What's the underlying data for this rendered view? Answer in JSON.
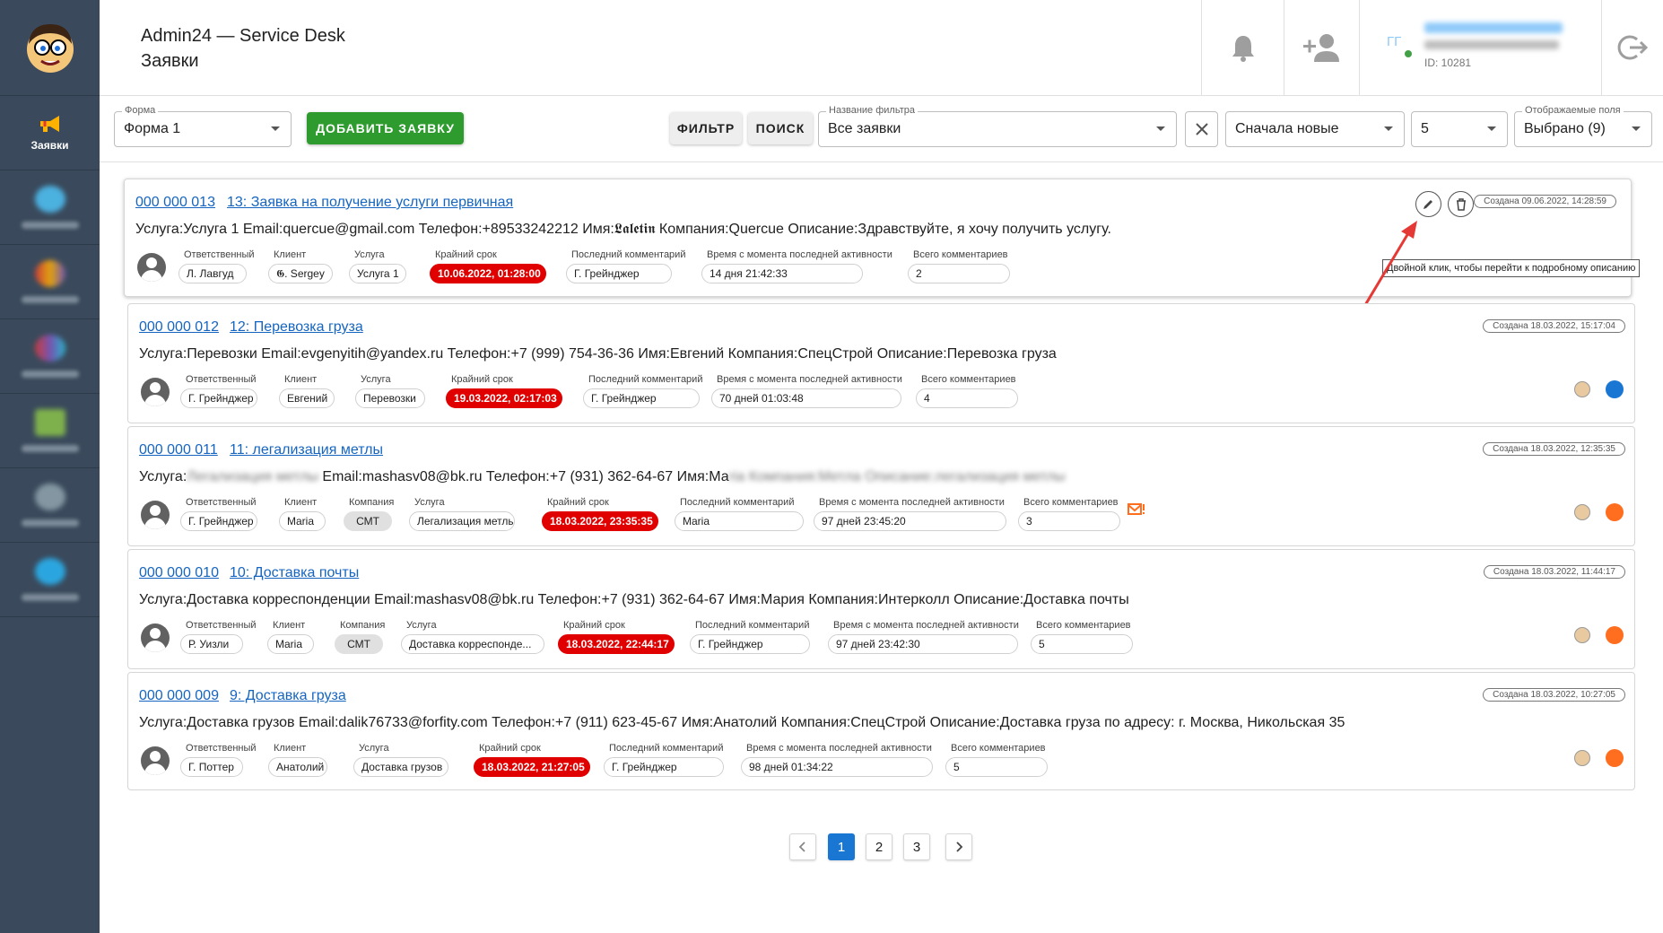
{
  "app": {
    "title": "Admin24 — Service Desk",
    "subtitle": "Заявки"
  },
  "sidebar": {
    "items": [
      {
        "label": "Заявки",
        "icon": "megaphone-icon"
      }
    ]
  },
  "header": {
    "user_initials": "ГГ",
    "user_id": "ID: 10281"
  },
  "toolbar": {
    "form_label": "Форма",
    "form_value": "Форма 1",
    "add_button": "ДОБАВИТЬ ЗАЯВКУ",
    "filter_button": "ФИЛЬТР",
    "search_button": "ПОИСК",
    "filter_name_label": "Название фильтра",
    "filter_name_value": "Все заявки",
    "sort_value": "Сначала новые",
    "per_page_value": "5",
    "fields_label": "Отображаемые поля",
    "fields_value": "Выбрано (9)"
  },
  "tooltip": "Двойной клик, чтобы перейти к подробному описанию",
  "cards": [
    {
      "id": "000 000 013",
      "title": "13: Заявка на получение услуги первичная",
      "desc": "Услуга:Услуга 1 Email:quercue@gmail.com Телефон:+89533242212 Имя:𝕷𝖆𝖑𝖊𝖙𝖎𝖓 Компания:Quercue Описание:Здравствуйте, я хочу получить услугу.",
      "created": "Создана 09.06.2022, 14:28:59",
      "fields": [
        {
          "label": "Ответственный",
          "value": "Л. Лавгуд"
        },
        {
          "label": "Клиент",
          "value": "𝕲. Sergey"
        },
        {
          "label": "Услуга",
          "value": "Услуга 1"
        },
        {
          "label": "Крайний срок",
          "value": "10.06.2022, 01:28:00"
        },
        {
          "label": "Последний комментарий",
          "value": "Г. Грейнджер"
        },
        {
          "label": "Время с момента последней активности",
          "value": "14 дня 21:42:33"
        },
        {
          "label": "Всего комментариев",
          "value": "2"
        }
      ]
    },
    {
      "id": "000 000 012",
      "title": "12: Перевозка груза",
      "desc": "Услуга:Перевозки Email:evgenyitih@yandex.ru Телефон:+7 (999) 754-36-36 Имя:Евгений Компания:СпецСтрой Описание:Перевозка груза",
      "created": "Создана 18.03.2022, 15:17:04",
      "fields": [
        {
          "label": "Ответственный",
          "value": "Г. Грейнджер"
        },
        {
          "label": "Клиент",
          "value": "Евгений"
        },
        {
          "label": "Услуга",
          "value": "Перевозки"
        },
        {
          "label": "Крайний срок",
          "value": "19.03.2022, 02:17:03"
        },
        {
          "label": "Последний комментарий",
          "value": "Г. Грейнджер"
        },
        {
          "label": "Время с момента последней активности",
          "value": "70 дней 01:03:48"
        },
        {
          "label": "Всего комментариев",
          "value": "4"
        }
      ]
    },
    {
      "id": "000 000 011",
      "title": "11: легализация метлы",
      "desc_a": "Услуга:",
      "desc_blur_a": "Легализация метлы",
      "desc_b": " Email:mashasv08@bk.ru Телефон:+7 (931) 362-64-67 Имя:Ма",
      "desc_blur_b": "ria Компания:Метла Описание:легализация метлы",
      "created": "Создана 18.03.2022, 12:35:35",
      "fields": [
        {
          "label": "Ответственный",
          "value": "Г. Грейнджер"
        },
        {
          "label": "Клиент",
          "value": "Maria"
        },
        {
          "label": "Компания",
          "value": "СМТ"
        },
        {
          "label": "Услуга",
          "value": "Легализация метлы"
        },
        {
          "label": "Крайний срок",
          "value": "18.03.2022, 23:35:35"
        },
        {
          "label": "Последний комментарий",
          "value": "Maria"
        },
        {
          "label": "Время с момента последней активности",
          "value": "97 дней 23:45:20"
        },
        {
          "label": "Всего комментариев",
          "value": "3"
        }
      ]
    },
    {
      "id": "000 000 010",
      "title": "10: Доставка почты",
      "desc": "Услуга:Доставка корреспонденции Email:mashasv08@bk.ru Телефон:+7 (931) 362-64-67 Имя:Мария Компания:Интерколл Описание:Доставка почты",
      "created": "Создана 18.03.2022, 11:44:17",
      "fields": [
        {
          "label": "Ответственный",
          "value": "Р. Уизли"
        },
        {
          "label": "Клиент",
          "value": "Maria"
        },
        {
          "label": "Компания",
          "value": "СМТ"
        },
        {
          "label": "Услуга",
          "value": "Доставка корреспонде..."
        },
        {
          "label": "Крайний срок",
          "value": "18.03.2022, 22:44:17"
        },
        {
          "label": "Последний комментарий",
          "value": "Г. Грейнджер"
        },
        {
          "label": "Время с момента последней активности",
          "value": "97 дней 23:42:30"
        },
        {
          "label": "Всего комментариев",
          "value": "5"
        }
      ]
    },
    {
      "id": "000 000 009",
      "title": "9: Доставка груза",
      "desc": "Услуга:Доставка грузов Email:dalik76733@forfity.com Телефон:+7 (911) 623-45-67 Имя:Анатолий Компания:СпецСтрой Описание:Доставка груза по адресу: г. Москва, Никольская 35",
      "created": "Создана 18.03.2022, 10:27:05",
      "fields": [
        {
          "label": "Ответственный",
          "value": "Г. Поттер"
        },
        {
          "label": "Клиент",
          "value": "Анатолий"
        },
        {
          "label": "Услуга",
          "value": "Доставка грузов"
        },
        {
          "label": "Крайний срок",
          "value": "18.03.2022, 21:27:05"
        },
        {
          "label": "Последний комментарий",
          "value": "Г. Грейнджер"
        },
        {
          "label": "Время с момента последней активности",
          "value": "98 дней 01:34:22"
        },
        {
          "label": "Всего комментариев",
          "value": "5"
        }
      ]
    }
  ],
  "status_colors": {
    "blue": "#1976d2",
    "orange": "#ff6d1f",
    "deadline_red": "#e00000",
    "add_green": "#2e9b2e"
  },
  "pagination": {
    "pages": [
      "1",
      "2",
      "3"
    ],
    "current": "1"
  }
}
